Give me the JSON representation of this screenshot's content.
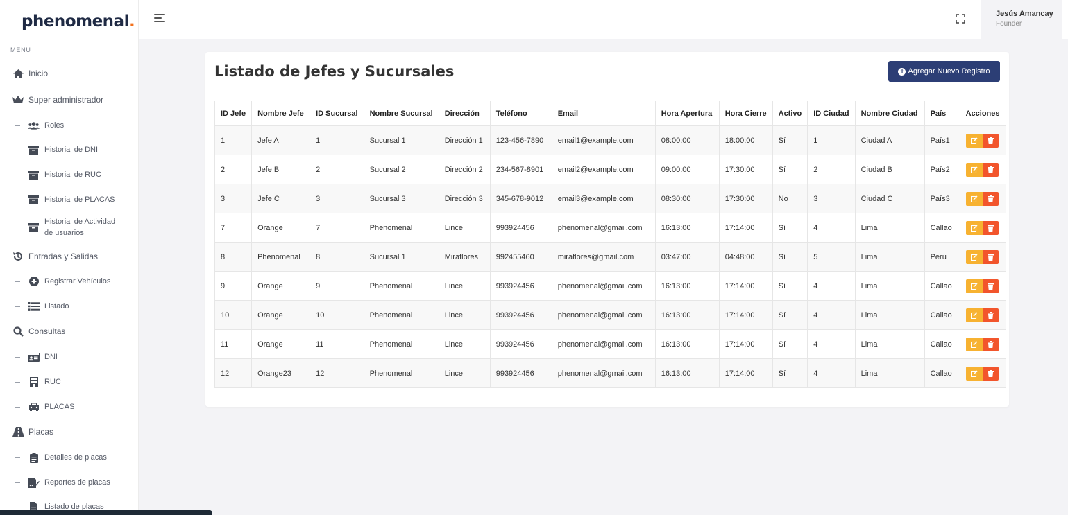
{
  "brand": {
    "name": "phenomenal",
    "dot": "."
  },
  "sidebar": {
    "menu_title": "MENU",
    "items": [
      {
        "label": "Inicio",
        "icon": "home-icon",
        "type": "top"
      },
      {
        "label": "Super administrador",
        "icon": "crown-icon",
        "type": "top"
      },
      {
        "label": "Roles",
        "icon": "users-icon",
        "type": "sub"
      },
      {
        "label": "Historial de DNI",
        "icon": "archive-icon",
        "type": "sub"
      },
      {
        "label": "Historial de RUC",
        "icon": "archive-icon",
        "type": "sub"
      },
      {
        "label": "Historial de PLACAS",
        "icon": "archive-icon",
        "type": "sub"
      },
      {
        "label_line1": "Historial de Actividad",
        "label_line2": "de usuarios",
        "icon": "archive-icon",
        "type": "sub"
      },
      {
        "label": "Entradas y Salidas",
        "icon": "history-icon",
        "type": "top"
      },
      {
        "label": "Registrar Vehículos",
        "icon": "plus-circle-icon",
        "type": "sub"
      },
      {
        "label": "Listado",
        "icon": "list-icon",
        "type": "sub"
      },
      {
        "label": "Consultas",
        "icon": "search-icon",
        "type": "top"
      },
      {
        "label": "DNI",
        "icon": "id-card-icon",
        "type": "sub"
      },
      {
        "label": "RUC",
        "icon": "building-icon",
        "type": "sub"
      },
      {
        "label": "PLACAS",
        "icon": "car-icon",
        "type": "sub"
      },
      {
        "label": "Placas",
        "icon": "road-icon",
        "type": "top"
      },
      {
        "label": "Detalles de placas",
        "icon": "clipboard-icon",
        "type": "sub"
      },
      {
        "label": "Reportes de placas",
        "icon": "file-signature-icon",
        "type": "sub"
      },
      {
        "label": "Listado de placas",
        "icon": "file-icon",
        "type": "sub"
      }
    ]
  },
  "header": {
    "user_name": "Jesús Amancay",
    "user_role": "Founder"
  },
  "main": {
    "title": "Listado de Jefes y Sucursales",
    "add_button": "Agregar Nuevo Registro",
    "columns": [
      "ID Jefe",
      "Nombre Jefe",
      "ID Sucursal",
      "Nombre Sucursal",
      "Dirección",
      "Teléfono",
      "Email",
      "Hora Apertura",
      "Hora Cierre",
      "Activo",
      "ID Ciudad",
      "Nombre Ciudad",
      "País",
      "Acciones"
    ],
    "rows": [
      [
        "1",
        "Jefe A",
        "1",
        "Sucursal 1",
        "Dirección 1",
        "123-456-7890",
        "email1@example.com",
        "08:00:00",
        "18:00:00",
        "Sí",
        "1",
        "Ciudad A",
        "País1"
      ],
      [
        "2",
        "Jefe B",
        "2",
        "Sucursal 2",
        "Dirección 2",
        "234-567-8901",
        "email2@example.com",
        "09:00:00",
        "17:30:00",
        "Sí",
        "2",
        "Ciudad B",
        "País2"
      ],
      [
        "3",
        "Jefe C",
        "3",
        "Sucursal 3",
        "Dirección 3",
        "345-678-9012",
        "email3@example.com",
        "08:30:00",
        "17:30:00",
        "No",
        "3",
        "Ciudad C",
        "País3"
      ],
      [
        "7",
        "Orange",
        "7",
        "Phenomenal",
        "Lince",
        "993924456",
        "phenomenal@gmail.com",
        "16:13:00",
        "17:14:00",
        "Sí",
        "4",
        "Lima",
        "Callao"
      ],
      [
        "8",
        "Phenomenal",
        "8",
        "Sucursal 1",
        "Miraflores",
        "992455460",
        "miraflores@gmail.com",
        "03:47:00",
        "04:48:00",
        "Sí",
        "5",
        "Lima",
        "Perú"
      ],
      [
        "9",
        "Orange",
        "9",
        "Phenomenal",
        "Lince",
        "993924456",
        "phenomenal@gmail.com",
        "16:13:00",
        "17:14:00",
        "Sí",
        "4",
        "Lima",
        "Callao"
      ],
      [
        "10",
        "Orange",
        "10",
        "Phenomenal",
        "Lince",
        "993924456",
        "phenomenal@gmail.com",
        "16:13:00",
        "17:14:00",
        "Sí",
        "4",
        "Lima",
        "Callao"
      ],
      [
        "11",
        "Orange",
        "11",
        "Phenomenal",
        "Lince",
        "993924456",
        "phenomenal@gmail.com",
        "16:13:00",
        "17:14:00",
        "Sí",
        "4",
        "Lima",
        "Callao"
      ],
      [
        "12",
        "Orange23",
        "12",
        "Phenomenal",
        "Lince",
        "993924456",
        "phenomenal@gmail.com",
        "16:13:00",
        "17:14:00",
        "Sí",
        "4",
        "Lima",
        "Callao"
      ]
    ]
  },
  "colors": {
    "primary": "#2c3e75",
    "edit": "#f7b231",
    "delete": "#f2552c",
    "brand_dot": "#f2711c"
  }
}
